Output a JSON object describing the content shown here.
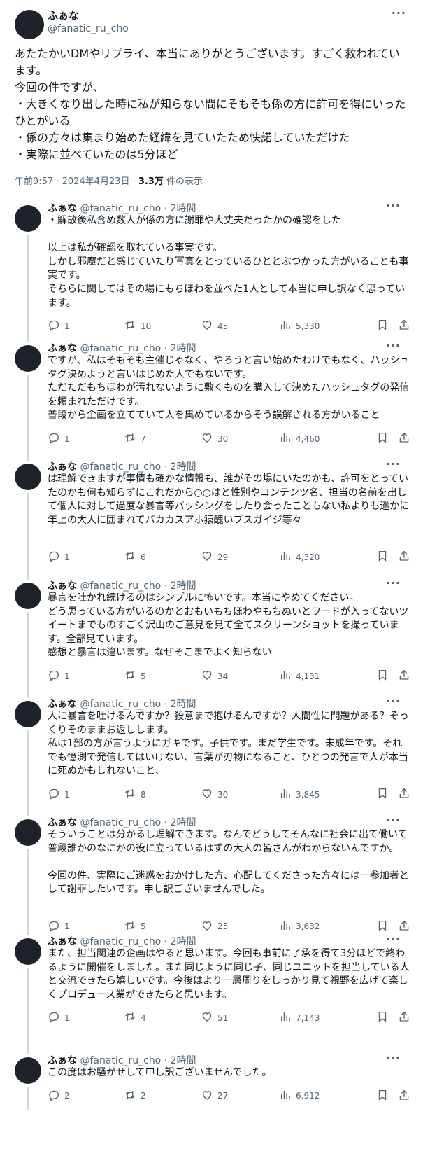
{
  "main_tweet": {
    "name": "ふぁな",
    "handle": "@fanatic_ru_cho",
    "text": "あたたかいDMやリプライ、本当にありがとうございます。すごく救われています。\n今回の件ですが、\n・大きくなり出した時に私が知らない間にそもそも係の方に許可を得にいったひとがいる\n・係の方々は集まり始めた経緯を見ていたため快諾していただけた\n・実際に並べていたのは5分ほど",
    "timestamp": "午前9:57 · 2024年4月23日 · ",
    "views": "3.3万",
    "views_suffix": " 件の表示"
  },
  "replies": [
    {
      "name": "ふぁな",
      "meta": " @fanatic_ru_cho · 2時間",
      "text": "・解散後私含め数人が係の方に謝罪や大丈夫だったかの確認をした\n\n以上は私が確認を取れている事実です。\nしかし邪魔だと感じていたり写真をとっているひととぶつかった方がいることも事実です。\nそちらに関してはその場にもちほわを並べた1人として本当に申し訳なく思っています。",
      "replies": "1",
      "retweets": "10",
      "likes": "45",
      "views": "5,330"
    },
    {
      "name": "ふぁな",
      "meta": " @fanatic_ru_cho · 2時間",
      "text": "ですが、私はそもそも主催じゃなく、やろうと言い始めたわけでもなく、ハッシュタグ決めようと言いはじめた人でもないです。\nただただもちほわが汚れないように敷くものを購入して決めたハッシュタグの発信を頼まれただけです。\n普段から企画を立てていて人を集めているからそう誤解される方がいること",
      "replies": "1",
      "retweets": "7",
      "likes": "30",
      "views": "4,460"
    },
    {
      "name": "ふぁな",
      "meta": " @fanatic_ru_cho · 2時間",
      "text": "は理解できますが事情も確かな情報も、誰がその場にいたのかも、許可をとっていたのかも何も知らずにこれだから○○はと性別やコンテンツ名、担当の名前を出して個人に対して過度な暴言等バッシングをしたり会ったこともない私よりも遥かに年上の大人に囲まれてバカカスアホ猿醜いブスガイジ等々",
      "replies": "1",
      "retweets": "6",
      "likes": "29",
      "views": "4,320"
    },
    {
      "name": "ふぁな",
      "meta": " @fanatic_ru_cho · 2時間",
      "text": "暴言を吐かれ続けるのはシンプルに怖いです。本当にやめてください。\nどう思っている方がいるのかとおもいもちほわやもちぬいとワードが入ってないツイートまでものすごく沢山のご意見を見て全てスクリーンショットを撮っています。全部見ています。\n感想と暴言は違います。なぜそこまでよく知らない",
      "replies": "1",
      "retweets": "5",
      "likes": "34",
      "views": "4,131"
    },
    {
      "name": "ふぁな",
      "meta": " @fanatic_ru_cho · 2時間",
      "text": "人に暴言を吐けるんですか？殺意まで抱けるんですか？人間性に問題がある？そっくりそのままお返しします。\n私は1部の方が言うようにガキです。子供です。まだ学生です。未成年です。それでも憶測で発信してはいけない、言葉が刃物になること、ひとつの発言で人が本当に死ぬかもしれないこと、",
      "replies": "1",
      "retweets": "8",
      "likes": "30",
      "views": "3,845"
    },
    {
      "name": "ふぁな",
      "meta": " @fanatic_ru_cho · 2時間",
      "text": "そういうことは分かるし理解できます。なんでどうしてそんなに社会に出て働いて普段誰かのなにかの役に立っているはずの大人の皆さんがわからないんですか。\n\n今回の件、実際にご迷惑をおかけした方、心配してくださった方々には一参加者として謝罪したいです。申し訳ございませんでした。",
      "replies": "1",
      "retweets": "5",
      "likes": "25",
      "views": "3,632"
    },
    {
      "name": "ふぁな",
      "meta": " @fanatic_ru_cho · 2時間",
      "text": "また、担当関連の企画はやると思います。今回も事前に了承を得て3分ほどで終わるように開催をしました。また同じように同じ子、同じユニットを担当している人と交流できたら嬉しいです。今後はより一層周りをしっかり見て視野を広げて楽しくプロデュース業ができたらと思います。",
      "replies": "1",
      "retweets": "4",
      "likes": "51",
      "views": "7,143"
    },
    {
      "name": "ふぁな",
      "meta": " @fanatic_ru_cho · 2時間",
      "text": "この度はお騒がせして申し訳ございませんでした。",
      "replies": "2",
      "retweets": "2",
      "likes": "27",
      "views": "6,912"
    }
  ]
}
